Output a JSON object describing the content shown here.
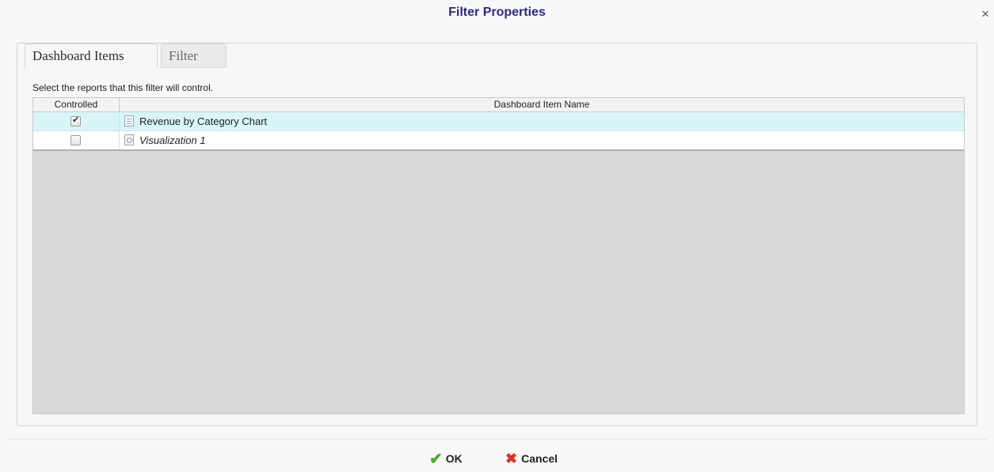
{
  "dialog": {
    "title": "Filter Properties",
    "close_symbol": "×"
  },
  "tabs": [
    {
      "label": "Dashboard Items",
      "active": true
    },
    {
      "label": "Filter",
      "active": false
    }
  ],
  "instructions": "Select the reports that this filter will control.",
  "grid": {
    "columns": [
      "Controlled",
      "Dashboard Item Name"
    ],
    "rows": [
      {
        "controlled": true,
        "icon": "report-icon",
        "name": "Revenue by Category Chart",
        "italic": false,
        "selected": true
      },
      {
        "controlled": false,
        "icon": "visualization-icon",
        "name": "Visualization 1",
        "italic": true,
        "selected": false
      }
    ]
  },
  "footer": {
    "ok_label": "OK",
    "cancel_label": "Cancel",
    "ok_icon": "checkmark-icon",
    "cancel_icon": "cross-icon"
  },
  "colors": {
    "title": "#2b2b7e",
    "selected_row": "#d8f5f8",
    "ok_icon": "#4caa2d",
    "cancel_icon": "#d2362b"
  }
}
